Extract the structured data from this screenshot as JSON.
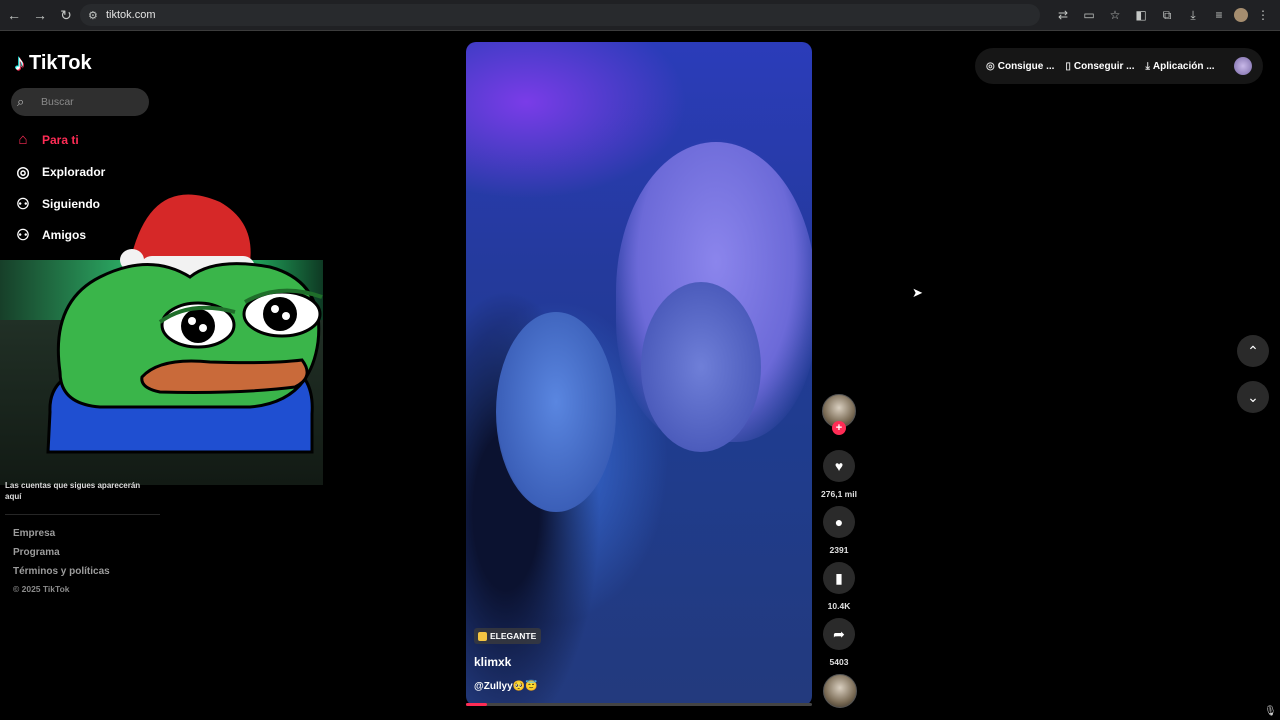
{
  "browser": {
    "url": "tiktok.com",
    "back_icon": "←",
    "forward_icon": "→",
    "reload_icon": "↻",
    "site_info_icon": "⚙"
  },
  "sidebar": {
    "logo_text": "TikTok",
    "logo_icon": "♪",
    "search_placeholder": "Buscar",
    "nav": [
      {
        "label": "Para ti",
        "icon": "⌂"
      },
      {
        "label": "Explorador",
        "icon": "◎"
      },
      {
        "label": "Siguiendo",
        "icon": "⚇"
      },
      {
        "label": "Amigos",
        "icon": "⚇"
      }
    ],
    "following_note": "Las cuentas que sigues aparecerán aquí",
    "footer": [
      "Empresa",
      "Programa",
      "Términos y políticas"
    ],
    "copyright": "© 2025 TikTok"
  },
  "top_actions": [
    {
      "label": "Consigue ...",
      "icon": "◎"
    },
    {
      "label": "Conseguir ...",
      "icon": "▯"
    },
    {
      "label": "Aplicación ...",
      "icon": "⤓"
    }
  ],
  "video": {
    "tag": "ELEGANTE",
    "author": "klimxk",
    "description": "@Zullyy🥺😇",
    "progress_fraction": 0.06
  },
  "actions": {
    "likes": "276,1 mil",
    "comments": "2391",
    "saves": "10.4K",
    "shares": "5403"
  },
  "colors": {
    "accent": "#fe2c55",
    "background": "#000000"
  }
}
